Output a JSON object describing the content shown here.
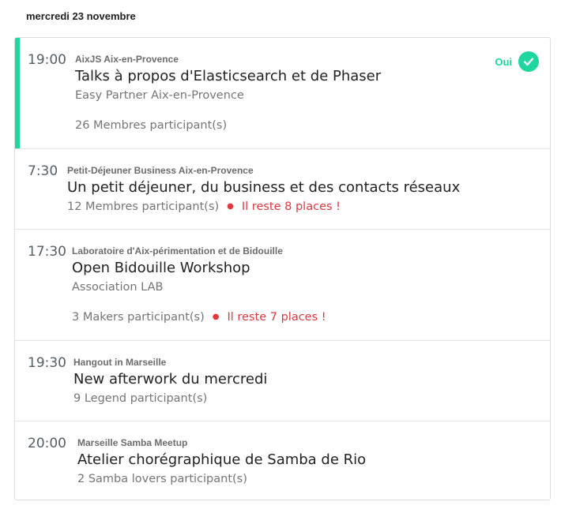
{
  "date_header": "mercredi 23 novembre",
  "colors": {
    "accent_green": "#1ed79f",
    "alert_red": "#e0393e"
  },
  "events": [
    {
      "time": "19:00",
      "group": "AixJS Aix-en-Provence",
      "title": "Talks à propos d'Elasticsearch et de Phaser",
      "venue": "Easy Partner Aix-en-Provence",
      "members": "26 Membres participant(s)",
      "rsvp_label": "Oui",
      "rsvp_icon": "check-circle-icon"
    },
    {
      "time": "7:30",
      "group": "Petit-Déjeuner Business Aix-en-Provence",
      "title": "Un petit déjeuner, du business et des contacts réseaux",
      "members": "12 Membres participant(s)",
      "places_left": "Il reste 8 places !"
    },
    {
      "time": "17:30",
      "group": "Laboratoire d'Aix-périmentation et de Bidouille",
      "title": "Open Bidouille Workshop",
      "venue": "Association LAB",
      "members": "3 Makers participant(s)",
      "places_left": "Il reste 7 places !"
    },
    {
      "time": "19:30",
      "group": "Hangout in Marseille",
      "title": "New afterwork du mercredi",
      "members": "9 Legend participant(s)"
    },
    {
      "time": "20:00",
      "group": "Marseille Samba Meetup",
      "title": "Atelier chorégraphique de Samba de Rio",
      "members": "2 Samba lovers participant(s)"
    }
  ]
}
